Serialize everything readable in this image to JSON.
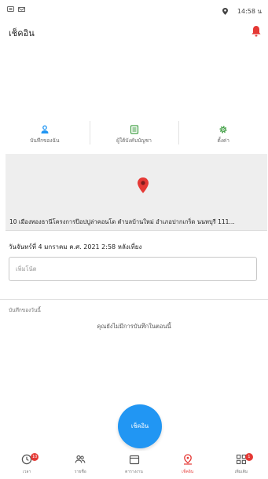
{
  "status_bar": {
    "time": "14:58 น",
    "left_icons": [
      "notification-icon",
      "app-icon"
    ],
    "right_icons": [
      "location-icon"
    ]
  },
  "app_bar": {
    "title": "เช็คอิน",
    "bell_color": "#e53935"
  },
  "actions": [
    {
      "label": "บันทึกของฉัน",
      "icon": "person-icon",
      "color": "#2196f3"
    },
    {
      "label": "ผู้ใต้บังคับบัญชา",
      "icon": "list-icon",
      "color": "#43a047"
    },
    {
      "label": "ตั้งค่า",
      "icon": "gear-icon",
      "color": "#43a047"
    }
  ],
  "map": {
    "pin_color": "#e53935",
    "address": "10 เมืองทองธานีโครงการป๊อปปูล่าคอนโด ตำบลบ้านใหม่ อำเภอปากเกร็ด นนทบุรี 111..."
  },
  "checkin": {
    "date_text": "วันจันทร์ที่ 4 มกราคม ค.ศ. 2021 2:58 หลังเที่ยง",
    "note_placeholder": "เพิ่มโน้ต"
  },
  "today": {
    "section_title": "บันทึกของวันนี้",
    "empty_text": "คุณยังไม่มีการบันทึกในตอนนี้"
  },
  "fab": {
    "label": "เช็คอิน",
    "color": "#2196f3"
  },
  "bottom_nav": [
    {
      "label": "เวลา",
      "icon": "clock-icon",
      "badge": "10",
      "active": false
    },
    {
      "label": "รายชื่อ",
      "icon": "people-icon",
      "badge": "",
      "active": false
    },
    {
      "label": "ตารางงาน",
      "icon": "calendar-icon",
      "badge": "",
      "active": false
    },
    {
      "label": "เช็คอิน",
      "icon": "checkin-pin-icon",
      "badge": "",
      "active": true
    },
    {
      "label": "เพิ่มเติม",
      "icon": "grid-icon",
      "badge": "1",
      "active": false
    }
  ]
}
